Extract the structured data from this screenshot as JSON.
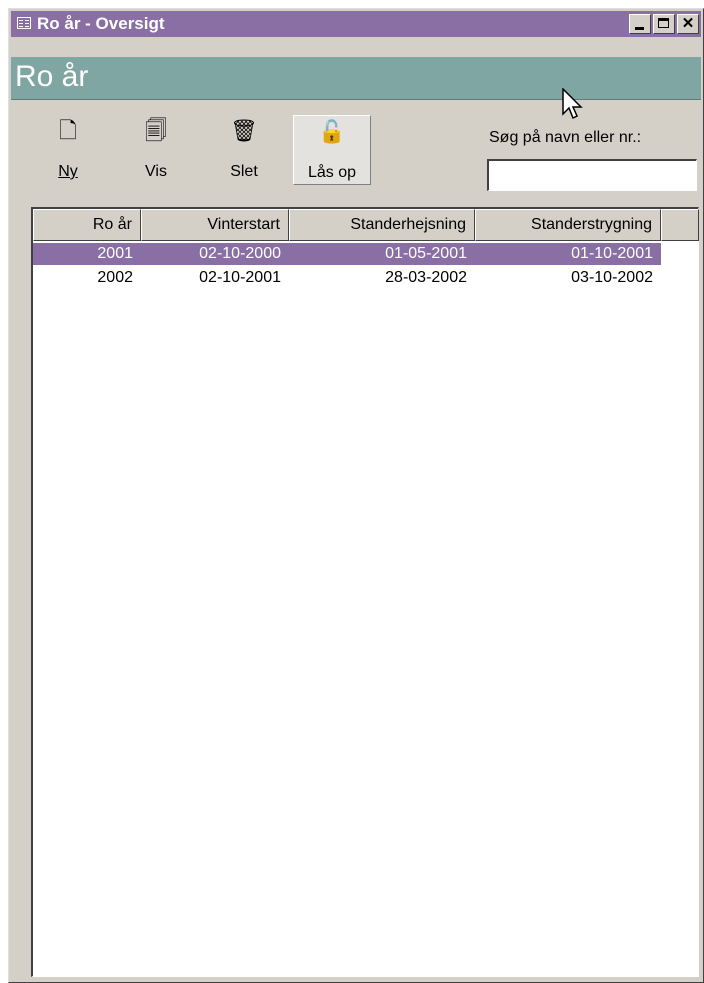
{
  "window": {
    "title": "Ro år - Oversigt",
    "controls": {
      "minimize": "minimize",
      "maximize": "maximize",
      "close": "✕"
    }
  },
  "header": {
    "title": "Ro år"
  },
  "toolbar": {
    "buttons": [
      {
        "label": "Ny",
        "icon": "new-document-icon",
        "glyph": "🗋"
      },
      {
        "label": "Vis",
        "icon": "view-icon",
        "glyph": "🗐"
      },
      {
        "label": "Slet",
        "icon": "delete-icon",
        "glyph": "🗑"
      },
      {
        "label": "Lås op",
        "icon": "unlock-icon",
        "glyph": "🔓",
        "active": true
      }
    ]
  },
  "search": {
    "label": "Søg på navn eller nr.:",
    "value": ""
  },
  "table": {
    "columns": [
      "Ro år",
      "Vinterstart",
      "Standerhejsning",
      "Standerstrygning"
    ],
    "rows": [
      [
        "2001",
        "02-10-2000",
        "01-05-2001",
        "01-10-2001"
      ],
      [
        "2002",
        "02-10-2001",
        "28-03-2002",
        "03-10-2002"
      ]
    ],
    "selected_row": 0
  },
  "colors": {
    "titlebar": "#8a6fa4",
    "header_band": "#7fa6a2",
    "selection": "#8a6fa4",
    "face": "#d4d0c8"
  }
}
